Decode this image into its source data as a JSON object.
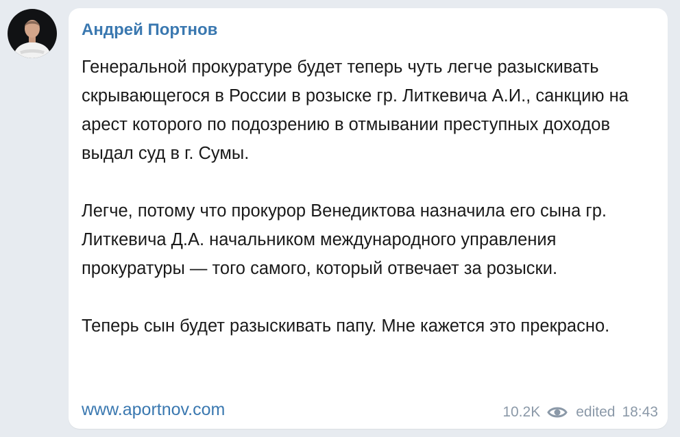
{
  "post": {
    "author": "Андрей Портнов",
    "paragraphs": [
      "Генеральной прокуратуре будет теперь чуть легче разыскивать скрывающегося в России в розыске гр. Литкевича А.И., санкцию на арест которого по подозрению в отмывании преступных доходов выдал суд в г. Сумы.",
      "Легче, потому что прокурор Венедиктова назначила его сына гр. Литкевича Д.А. начальником международного управления прокуратуры — того самого, который отвечает за розыски.",
      "Теперь сын будет разыскивать папу. Мне кажется это прекрасно."
    ],
    "link": "www.aportnov.com",
    "views": "10.2K",
    "views_icon": "eye-icon",
    "edited": "edited",
    "time": "18:43"
  },
  "colors": {
    "background": "#e7ebf0",
    "bubble": "#ffffff",
    "accent": "#3a78b0",
    "meta": "#8b99a8"
  }
}
